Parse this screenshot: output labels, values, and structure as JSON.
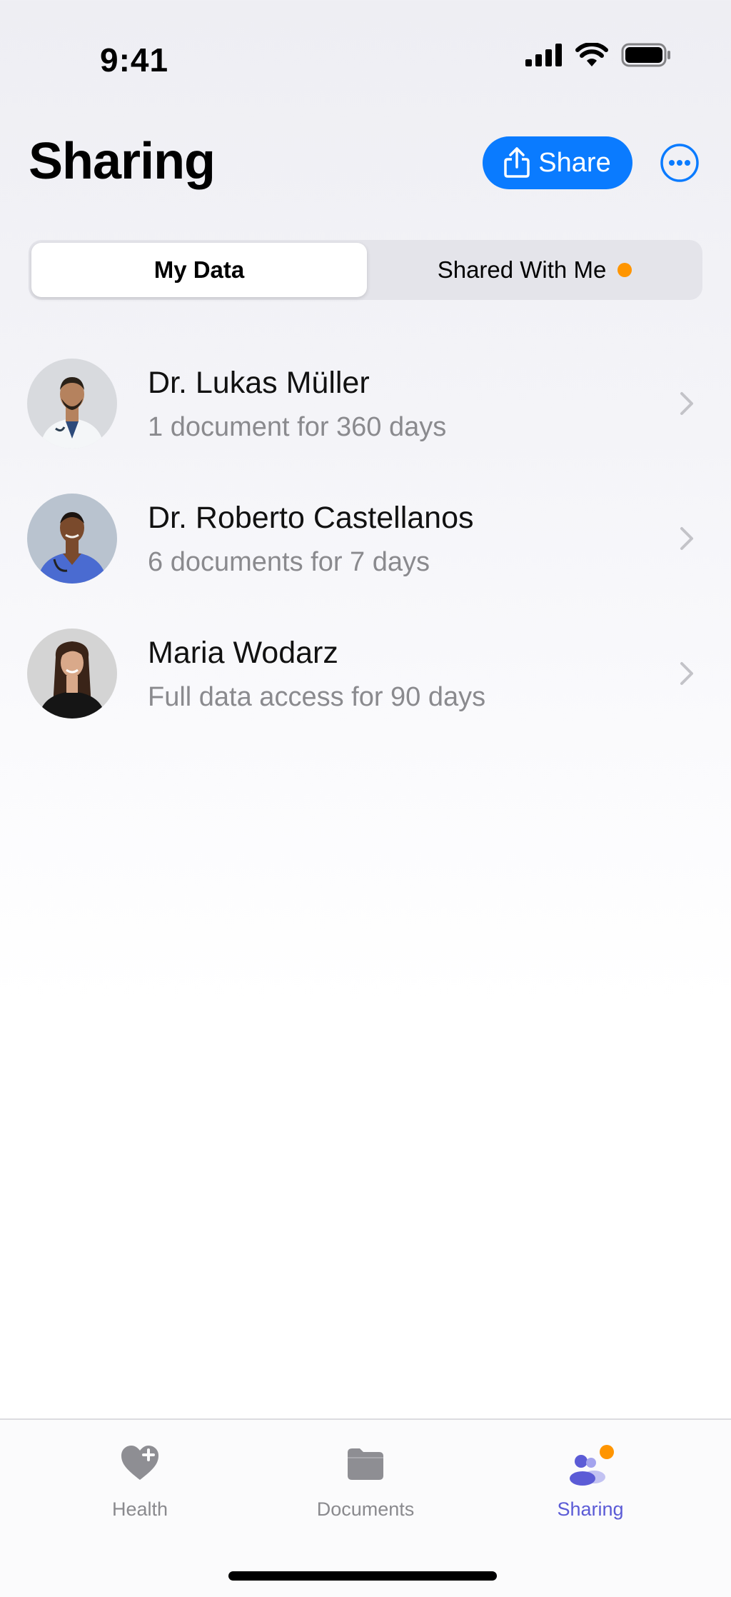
{
  "status_bar": {
    "time": "9:41"
  },
  "header": {
    "title": "Sharing",
    "share_label": "Share",
    "share_icon": "share-icon",
    "more_icon": "ellipsis-circle-icon"
  },
  "segmented": {
    "options": [
      {
        "label": "My Data",
        "selected": true
      },
      {
        "label": "Shared With Me",
        "selected": false,
        "badge": true
      }
    ]
  },
  "shares": [
    {
      "name": "Dr. Lukas Müller",
      "detail": "1 document for 360 days"
    },
    {
      "name": "Dr. Roberto Castellanos",
      "detail": "6 documents for 7 days"
    },
    {
      "name": "Maria Wodarz",
      "detail": "Full data access for 90 days"
    }
  ],
  "tab_bar": {
    "tabs": [
      {
        "label": "Health",
        "icon": "heart-plus-icon",
        "active": false
      },
      {
        "label": "Documents",
        "icon": "folder-icon",
        "active": false
      },
      {
        "label": "Sharing",
        "icon": "people-icon",
        "active": true
      }
    ]
  },
  "colors": {
    "accent": "#0a7bff",
    "active_tab": "#5b5bd6",
    "badge": "#ff9500",
    "secondary_text": "#8a8a8e"
  }
}
